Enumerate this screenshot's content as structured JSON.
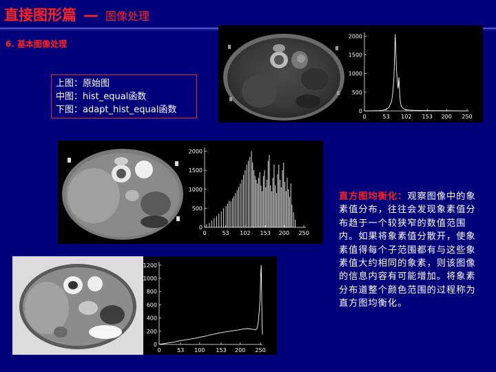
{
  "header": {
    "title": "直接图形篇",
    "separator": "—",
    "subtitle": "图像处理"
  },
  "section_title": "6. 基本图像处理",
  "note": {
    "lines": [
      "上图：原始图",
      "中图：hist_equal函数",
      "下图：adapt_hist_equal函数"
    ]
  },
  "description": {
    "highlight": "直方图均衡化：",
    "body": "观察图像中的象素值分布，往往会发现象素值分布趋于一个较狭窄的数值范围内。如果将象素值分散开，使象素值得每个子范围都有与这些象素值大约相同的象素，则该图像的信息内容有可能增加。将象素分布道整个颜色范围的过程称为直方图均衡化。"
  },
  "chart_data": [
    {
      "type": "line",
      "description_label": "原始图 histogram",
      "x_ticks": [
        "0",
        "53",
        "102",
        "153",
        "200",
        "250"
      ],
      "y_ticks": [
        "0",
        "500",
        "1000",
        "1500",
        "2000"
      ],
      "xlim": [
        0,
        255
      ],
      "ylim": [
        0,
        2100
      ],
      "points": [
        [
          0,
          0
        ],
        [
          20,
          3
        ],
        [
          35,
          8
        ],
        [
          45,
          15
        ],
        [
          50,
          35
        ],
        [
          55,
          60
        ],
        [
          60,
          100
        ],
        [
          63,
          180
        ],
        [
          66,
          250
        ],
        [
          68,
          380
        ],
        [
          70,
          600
        ],
        [
          72,
          900
        ],
        [
          73,
          1300
        ],
        [
          74,
          1700
        ],
        [
          75,
          2050
        ],
        [
          76,
          1750
        ],
        [
          77,
          1400
        ],
        [
          78,
          1100
        ],
        [
          80,
          800
        ],
        [
          82,
          600
        ],
        [
          84,
          900
        ],
        [
          86,
          400
        ],
        [
          88,
          200
        ],
        [
          90,
          120
        ],
        [
          95,
          60
        ],
        [
          100,
          30
        ],
        [
          110,
          20
        ],
        [
          120,
          15
        ],
        [
          140,
          10
        ],
        [
          160,
          8
        ],
        [
          180,
          5
        ],
        [
          200,
          5
        ],
        [
          220,
          3
        ],
        [
          240,
          2
        ],
        [
          250,
          0
        ]
      ]
    },
    {
      "type": "bar",
      "description_label": "hist_equal histogram",
      "x_ticks": [
        "0",
        "53",
        "102",
        "153",
        "200",
        "250"
      ],
      "y_ticks": [
        "0",
        "500",
        "1000",
        "1500",
        "2000"
      ],
      "xlim": [
        0,
        255
      ],
      "ylim": [
        0,
        2100
      ],
      "bars": [
        [
          0,
          40
        ],
        [
          5,
          80
        ],
        [
          12,
          120
        ],
        [
          18,
          180
        ],
        [
          24,
          240
        ],
        [
          30,
          300
        ],
        [
          36,
          360
        ],
        [
          42,
          420
        ],
        [
          48,
          500
        ],
        [
          54,
          560
        ],
        [
          58,
          620
        ],
        [
          62,
          700
        ],
        [
          66,
          680
        ],
        [
          70,
          760
        ],
        [
          74,
          820
        ],
        [
          78,
          900
        ],
        [
          82,
          980
        ],
        [
          86,
          1060
        ],
        [
          90,
          1150
        ],
        [
          94,
          1250
        ],
        [
          98,
          1380
        ],
        [
          102,
          1500
        ],
        [
          106,
          1650
        ],
        [
          110,
          1750
        ],
        [
          114,
          1850
        ],
        [
          118,
          2000
        ],
        [
          121,
          1700
        ],
        [
          124,
          1500
        ],
        [
          127,
          1350
        ],
        [
          130,
          1250
        ],
        [
          133,
          1150
        ],
        [
          136,
          1300
        ],
        [
          139,
          1450
        ],
        [
          142,
          1100
        ],
        [
          145,
          950
        ],
        [
          148,
          1350
        ],
        [
          151,
          1500
        ],
        [
          154,
          1050
        ],
        [
          157,
          1250
        ],
        [
          160,
          1750
        ],
        [
          163,
          1900
        ],
        [
          166,
          1100
        ],
        [
          169,
          950
        ],
        [
          172,
          1300
        ],
        [
          175,
          1650
        ],
        [
          178,
          1100
        ],
        [
          181,
          900
        ],
        [
          184,
          1400
        ],
        [
          187,
          1650
        ],
        [
          190,
          1250
        ],
        [
          193,
          1050
        ],
        [
          196,
          1500
        ],
        [
          199,
          1700
        ],
        [
          202,
          1200
        ],
        [
          205,
          950
        ],
        [
          208,
          1300
        ],
        [
          211,
          1000
        ],
        [
          214,
          800
        ],
        [
          217,
          1150
        ],
        [
          220,
          600
        ],
        [
          224,
          400
        ],
        [
          228,
          200
        ]
      ]
    },
    {
      "type": "line",
      "description_label": "adapt_hist_equal histogram",
      "x_ticks": [
        "0",
        "53",
        "100",
        "153",
        "200",
        "250"
      ],
      "y_ticks": [
        "0",
        "200",
        "400",
        "600",
        "800",
        "1000",
        "1200"
      ],
      "xlim": [
        0,
        255
      ],
      "ylim": [
        0,
        1250
      ],
      "points": [
        [
          0,
          0
        ],
        [
          5,
          5
        ],
        [
          10,
          10
        ],
        [
          20,
          20
        ],
        [
          30,
          30
        ],
        [
          40,
          40
        ],
        [
          50,
          55
        ],
        [
          60,
          65
        ],
        [
          70,
          75
        ],
        [
          80,
          85
        ],
        [
          90,
          95
        ],
        [
          100,
          110
        ],
        [
          110,
          120
        ],
        [
          120,
          135
        ],
        [
          130,
          150
        ],
        [
          140,
          160
        ],
        [
          150,
          175
        ],
        [
          160,
          185
        ],
        [
          170,
          195
        ],
        [
          180,
          205
        ],
        [
          190,
          215
        ],
        [
          200,
          225
        ],
        [
          210,
          235
        ],
        [
          220,
          240
        ],
        [
          230,
          230
        ],
        [
          238,
          220
        ],
        [
          242,
          250
        ],
        [
          245,
          350
        ],
        [
          247,
          500
        ],
        [
          249,
          700
        ],
        [
          250,
          900
        ],
        [
          251,
          1100
        ],
        [
          252,
          1200
        ],
        [
          253,
          800
        ],
        [
          254,
          300
        ],
        [
          255,
          150
        ]
      ]
    }
  ]
}
